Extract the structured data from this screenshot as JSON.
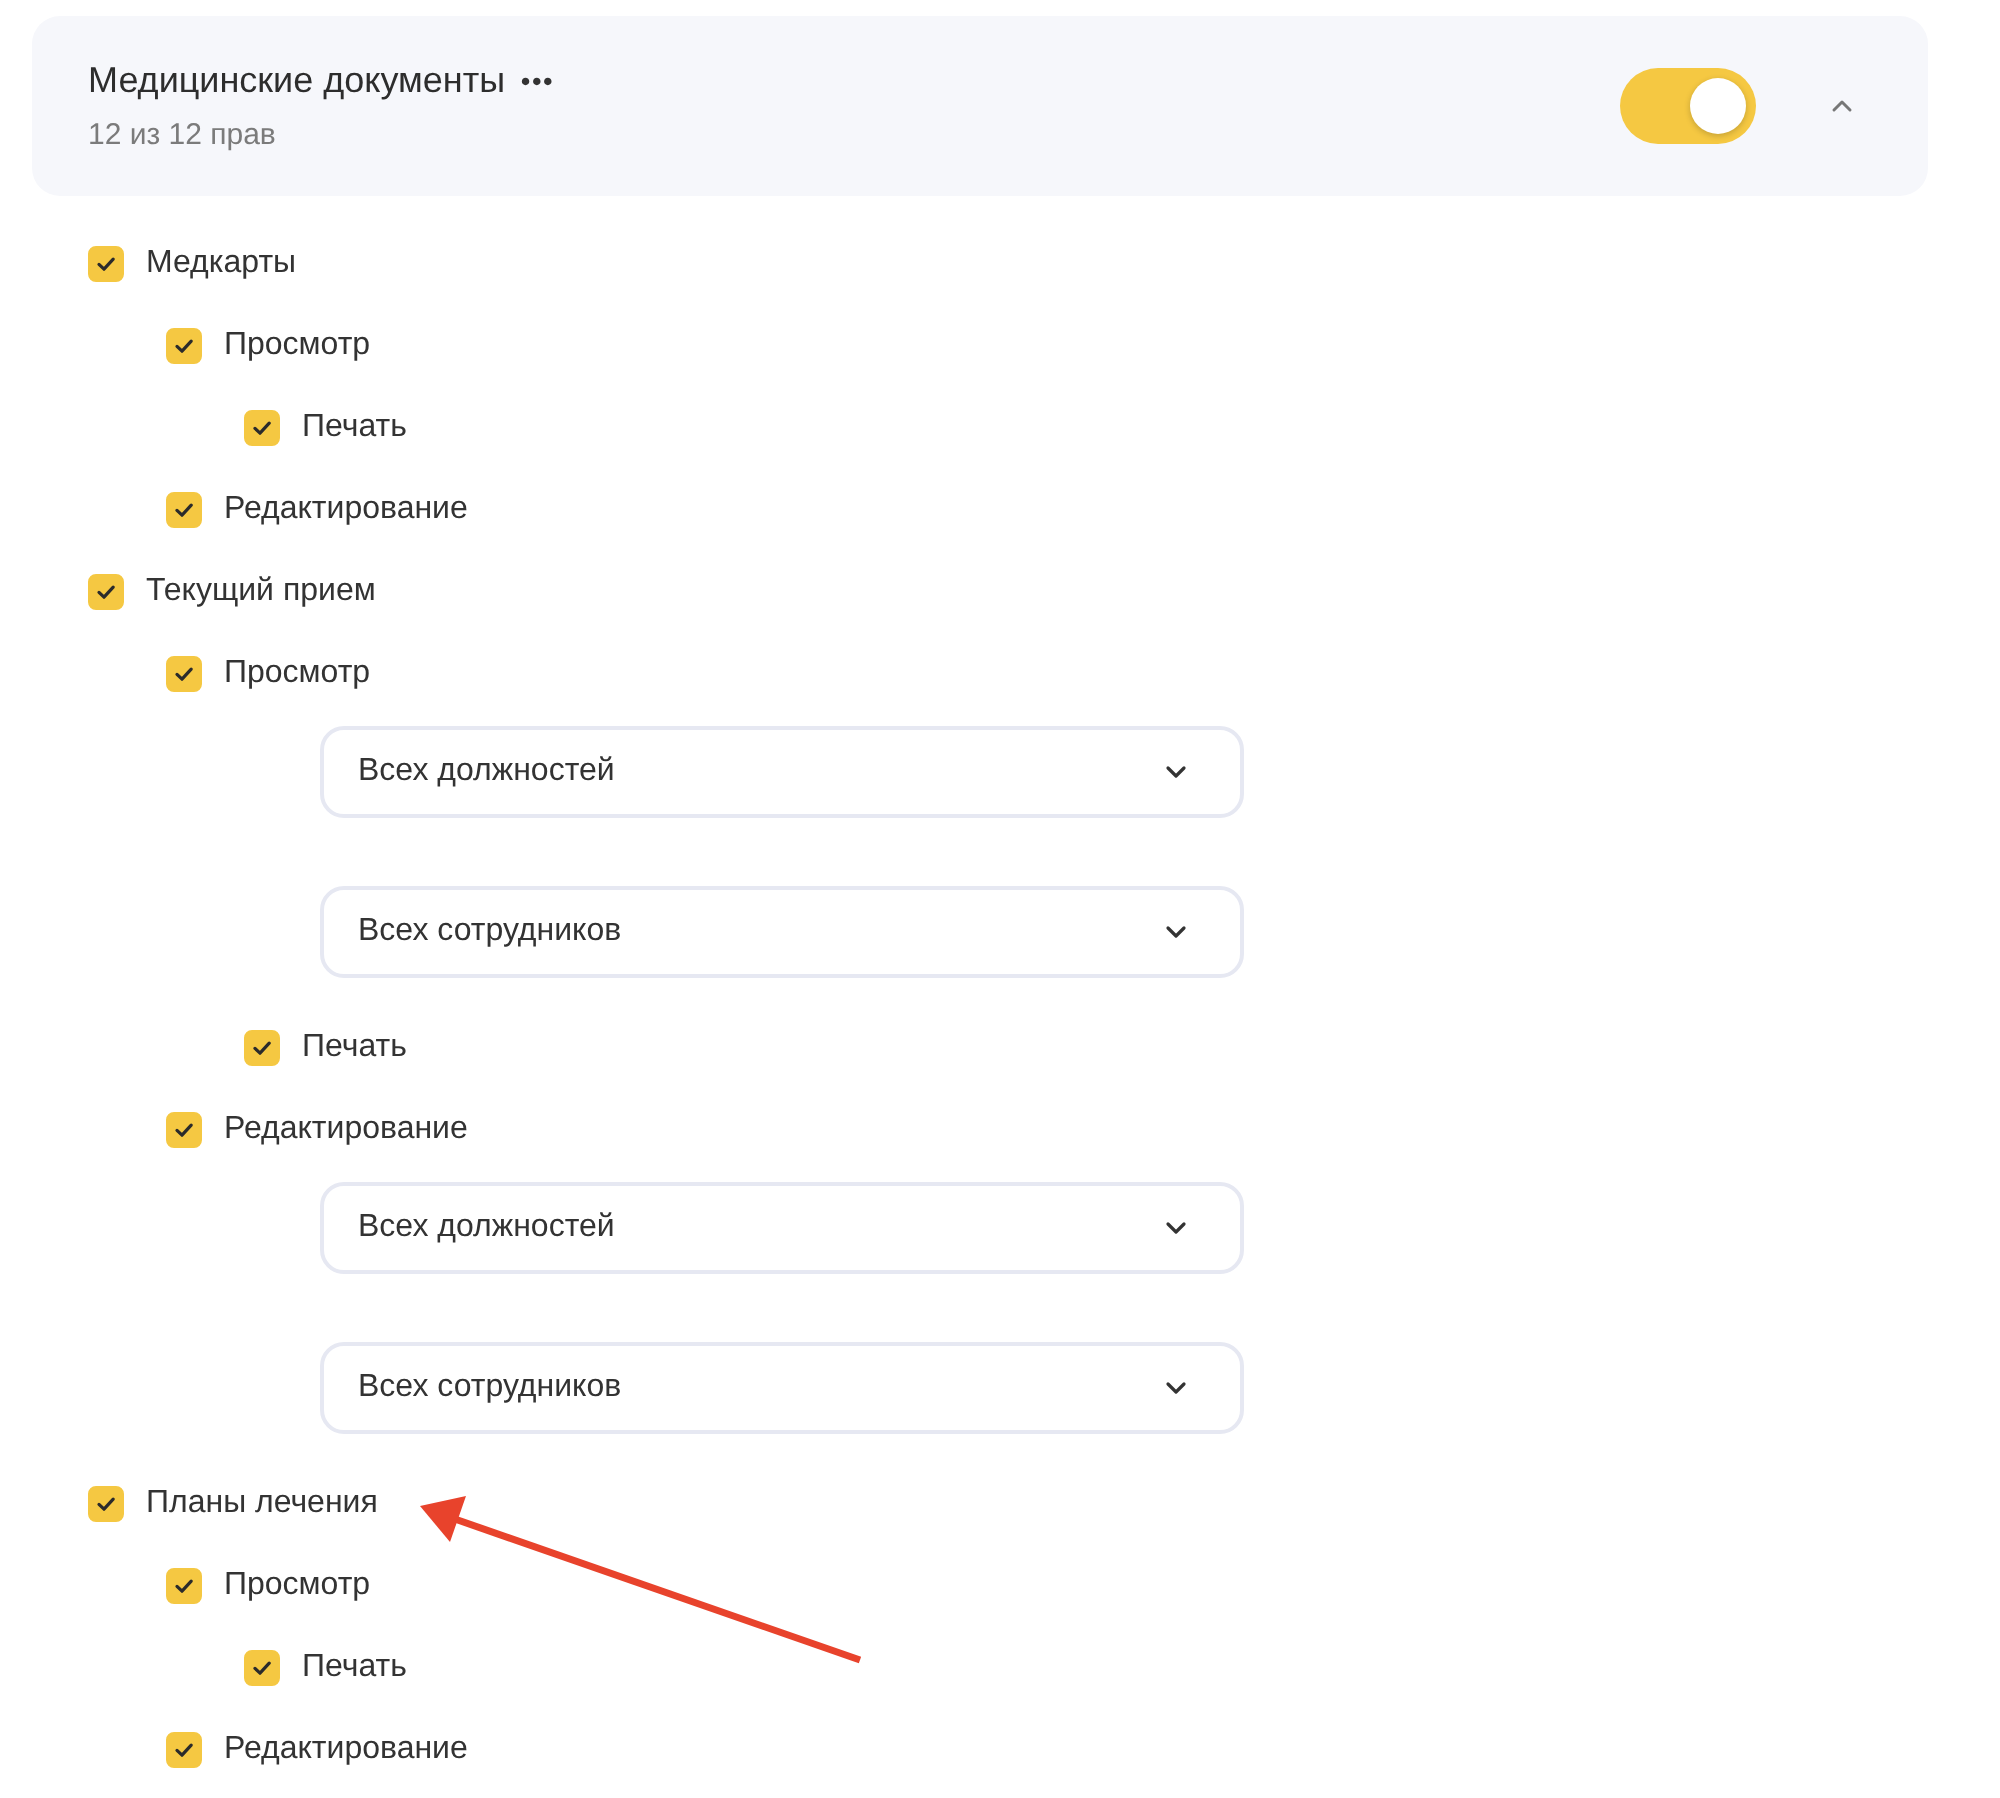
{
  "section": {
    "title": "Медицинские документы",
    "more_icon": "•••",
    "subtitle": "12 из 12 прав",
    "enabled": true,
    "expanded": true
  },
  "permissions": [
    {
      "label": "Медкарты",
      "checked": true,
      "children": [
        {
          "label": "Просмотр",
          "checked": true,
          "children": [
            {
              "label": "Печать",
              "checked": true
            }
          ]
        },
        {
          "label": "Редактирование",
          "checked": true
        }
      ]
    },
    {
      "label": "Текущий прием",
      "checked": true,
      "children": [
        {
          "label": "Просмотр",
          "checked": true,
          "selects": [
            "Всех должностей",
            "Всех сотрудников"
          ],
          "children": [
            {
              "label": "Печать",
              "checked": true
            }
          ]
        },
        {
          "label": "Редактирование",
          "checked": true,
          "selects": [
            "Всех должностей",
            "Всех сотрудников"
          ]
        }
      ]
    },
    {
      "label": "Планы лечения",
      "checked": true,
      "children": [
        {
          "label": "Просмотр",
          "checked": true,
          "children": [
            {
              "label": "Печать",
              "checked": true
            }
          ]
        },
        {
          "label": "Редактирование",
          "checked": true
        }
      ]
    }
  ]
}
